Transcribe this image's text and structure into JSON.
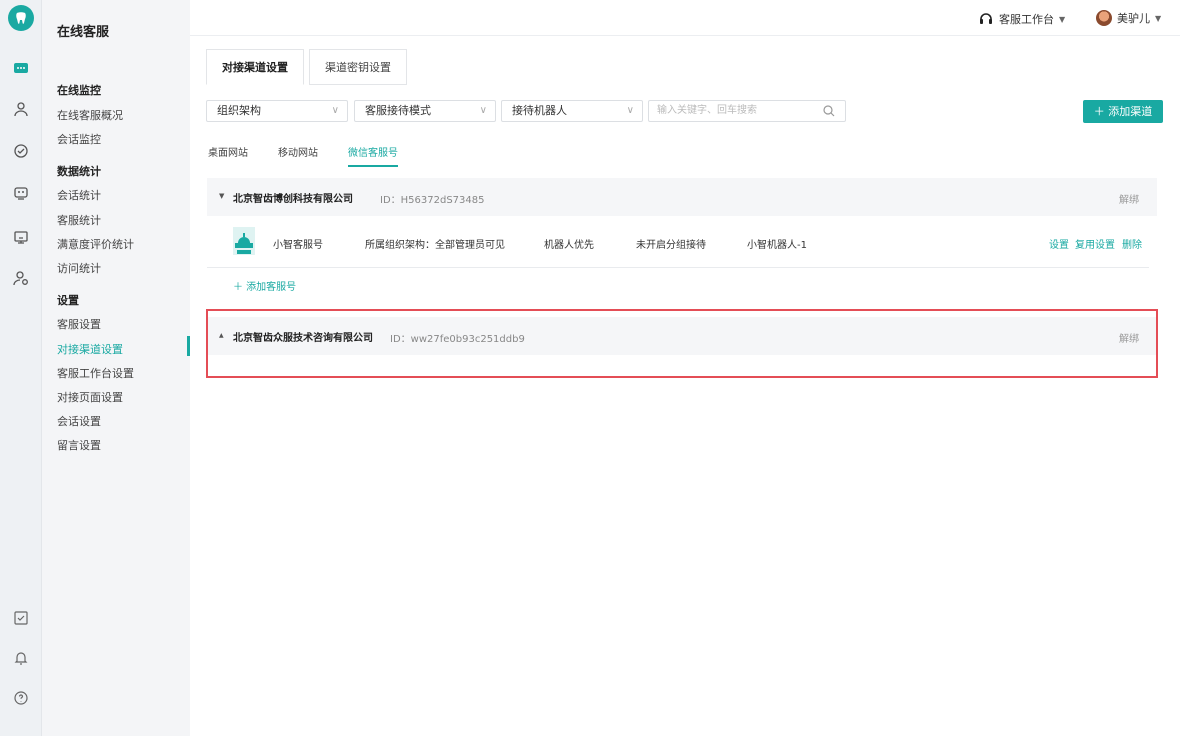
{
  "topbar": {
    "workspace": "客服工作台",
    "user": "美驴儿"
  },
  "sidebar": {
    "title": "在线客服",
    "groups": [
      {
        "label": "在线监控",
        "items": [
          "在线客服概况",
          "会话监控"
        ]
      },
      {
        "label": "数据统计",
        "items": [
          "会话统计",
          "客服统计",
          "满意度评价统计",
          "访问统计"
        ]
      },
      {
        "label": "设置",
        "items": [
          "客服设置",
          "对接渠道设置",
          "客服工作台设置",
          "对接页面设置",
          "会话设置",
          "留言设置"
        ]
      }
    ],
    "active_item": "对接渠道设置"
  },
  "tabs": [
    "对接渠道设置",
    "渠道密钥设置"
  ],
  "filters": {
    "org": "组织架构",
    "mode": "客服接待模式",
    "robot": "接待机器人",
    "search_placeholder": "输入关键字、回车搜索"
  },
  "add_channel_label": "＋ 添加渠道",
  "subtabs": [
    "桌面网站",
    "移动网站",
    "微信客服号"
  ],
  "companies": [
    {
      "name": "北京智齿博创科技有限公司",
      "id_text": "ID：H56372dS73485",
      "unbind": "解绑",
      "accounts": [
        {
          "name": "小智客服号",
          "org": "所属组织架构：全部管理员可见",
          "priority": "机器人优先",
          "group": "未开启分组接待",
          "robot": "小智机器人-1",
          "ops": [
            "设置",
            "复用设置",
            "删除"
          ]
        }
      ],
      "add_account": "＋ 添加客服号"
    },
    {
      "name": "北京智齿众服技术咨询有限公司",
      "id_text": "ID：ww27fe0b93c251ddb9",
      "unbind": "解绑"
    }
  ],
  "colors": {
    "accent": "#19a9a2",
    "highlight": "#e44d56"
  }
}
